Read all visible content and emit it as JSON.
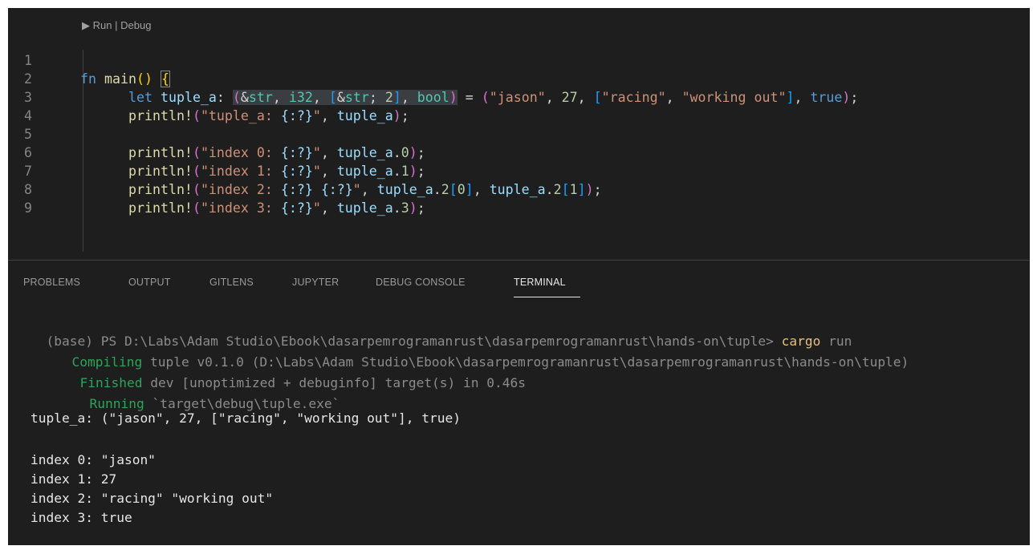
{
  "editor": {
    "codelens": {
      "run": "Run",
      "sep": "|",
      "debug": "Debug",
      "arrow": "▶"
    },
    "line_numbers": [
      "1",
      "2",
      "3",
      "4",
      "5",
      "6",
      "7",
      "8",
      "9"
    ],
    "lines": {
      "l1": {
        "fn": "fn",
        "name": "main",
        "paren": "()",
        "brace": "{"
      },
      "l2": {
        "let": "let",
        "var": "tuple_a",
        "colon": ": ",
        "open": "(",
        "amp": "&",
        "str": "str",
        "c1": ", ",
        "i32": "i32",
        "c2": ", ",
        "arr_open": "[",
        "amp2": "&",
        "str2": "str",
        "semi": "; ",
        "two": "2",
        "arr_close": "]",
        "c3": ", ",
        "bool": "bool",
        "close": ")",
        "eq": " = ",
        "p_open": "(",
        "s_jason": "\"jason\"",
        "c4": ", ",
        "n27": "27",
        "c5": ", ",
        "a_open": "[",
        "s_racing": "\"racing\"",
        "c6": ", ",
        "s_working": "\"working out\"",
        "a_close": "]",
        "c7": ", ",
        "t_true": "true",
        "p_close": ")",
        "end": ";"
      },
      "l3": {
        "mac": "println!",
        "open": "(",
        "s1": "\"tuple_a: ",
        "fmt": "{:?}",
        "s2": "\"",
        "comma": ", ",
        "arg": "tuple_a",
        "close": ")",
        "end": ";"
      },
      "l5": {
        "mac": "println!",
        "open": "(",
        "s1": "\"index 0: ",
        "fmt": "{:?}",
        "s2": "\"",
        "comma": ", ",
        "arg": "tuple_a",
        "dot": ".",
        "idx": "0",
        "close": ")",
        "end": ";"
      },
      "l6": {
        "mac": "println!",
        "open": "(",
        "s1": "\"index 1: ",
        "fmt": "{:?}",
        "s2": "\"",
        "comma": ", ",
        "arg": "tuple_a",
        "dot": ".",
        "idx": "1",
        "close": ")",
        "end": ";"
      },
      "l7": {
        "mac": "println!",
        "open": "(",
        "s1": "\"index 2: ",
        "fmt1": "{:?}",
        "sp": " ",
        "fmt2": "{:?}",
        "s2": "\"",
        "comma": ", ",
        "arg1": "tuple_a",
        "dot1": ".",
        "two1": "2",
        "b1o": "[",
        "i0": "0",
        "b1c": "]",
        "comma2": ", ",
        "arg2": "tuple_a",
        "dot2": ".",
        "two2": "2",
        "b2o": "[",
        "i1": "1",
        "b2c": "]",
        "close": ")",
        "end": ";"
      },
      "l8": {
        "mac": "println!",
        "open": "(",
        "s1": "\"index 3: ",
        "fmt": "{:?}",
        "s2": "\"",
        "comma": ", ",
        "arg": "tuple_a",
        "dot": ".",
        "idx": "3",
        "close": ")",
        "end": ";"
      }
    }
  },
  "panel": {
    "tabs": [
      "PROBLEMS",
      "OUTPUT",
      "GITLENS",
      "JUPYTER",
      "DEBUG CONSOLE",
      "TERMINAL"
    ],
    "active_tab": "TERMINAL"
  },
  "terminal": {
    "prompt": "(base) PS D:\\Labs\\Adam Studio\\Ebook\\dasarpemrogramanrust\\dasarpemrogramanrust\\hands-on\\tuple> ",
    "cmd": "cargo",
    "cmd_arg": " run",
    "compiling_label": "Compiling",
    "compiling_text": " tuple v0.1.0 (D:\\Labs\\Adam Studio\\Ebook\\dasarpemrogramanrust\\dasarpemrogramanrust\\hands-on\\tuple)",
    "finished_label": "Finished",
    "finished_text": " dev [unoptimized + debuginfo] target(s) in 0.46s",
    "running_label": "Running",
    "running_text": " `target\\debug\\tuple.exe`",
    "output": [
      "tuple_a: (\"jason\", 27, [\"racing\", \"working out\"], true)",
      "index 0: \"jason\"",
      "index 1: 27",
      "index 2: \"racing\" \"working out\"",
      "index 3: true"
    ]
  }
}
